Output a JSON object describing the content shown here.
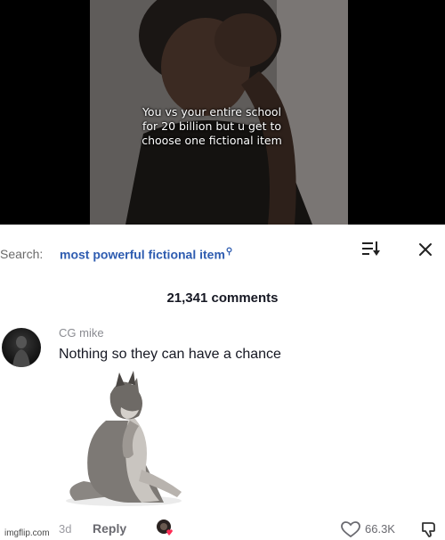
{
  "video": {
    "caption_lines": [
      "You vs your entire school",
      "for 20 billion but u get to",
      "choose one fictional item"
    ]
  },
  "comments_panel": {
    "search_label": "Search:",
    "search_query": "most powerful fictional item",
    "search_icon": "search-icon",
    "sort_icon": "sort-icon",
    "close_icon": "close-icon",
    "comment_count": "21,341 comments"
  },
  "comment": {
    "username": "CG mike",
    "text": "Nothing so they can have a chance",
    "time": "3d",
    "reply_label": "Reply",
    "likes": "66.3K"
  },
  "watermark": "imgflip.com",
  "colors": {
    "query_blue": "#2e5cb0",
    "text_dark": "#161823",
    "text_gray": "#8a8b91"
  }
}
